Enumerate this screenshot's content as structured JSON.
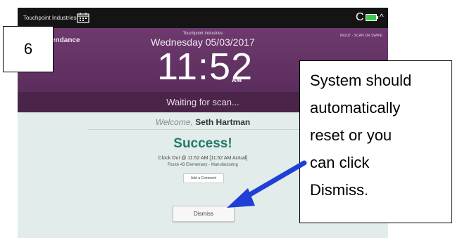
{
  "topbar": {
    "app_name": "Touchpoint Industries",
    "calendar_icon": "calendar-icon",
    "refresh_icon": "refresh-icon",
    "battery_icon": "battery-icon",
    "chevron_icon": "chevron-up-icon",
    "refresh_glyph": "C",
    "chevron_glyph": "^"
  },
  "header": {
    "section_title": "endance",
    "top_right": "INOUT - SCAN OR SWIPE",
    "company": "Touchpoint Industries",
    "date": "Wednesday 05/03/2017",
    "time": "11:52",
    "ampm": "AM"
  },
  "scan": {
    "waiting": "Waiting for scan..."
  },
  "result": {
    "welcome_prefix": "Welcome,",
    "user_name": "Seth Hartman",
    "status": "Success!",
    "clock_out": "Clock Out @ 11:52 AM [11:52 AM Actual]",
    "location": "Route 43 Elementary - Manufacturing",
    "add_comment_label": "Add a Comment",
    "dismiss_label": "Dismiss"
  },
  "annotation": {
    "step_number": "6",
    "note_lines": [
      "System should",
      "automatically",
      "reset or you",
      "can click",
      "Dismiss."
    ],
    "arrow_color": "#1f3fd6"
  },
  "colors": {
    "purple": "#6e3a6e",
    "dark_purple": "#4a2449",
    "success_green": "#22796b",
    "panel_bg": "#e2eceb",
    "battery_green": "#3cc84a"
  }
}
